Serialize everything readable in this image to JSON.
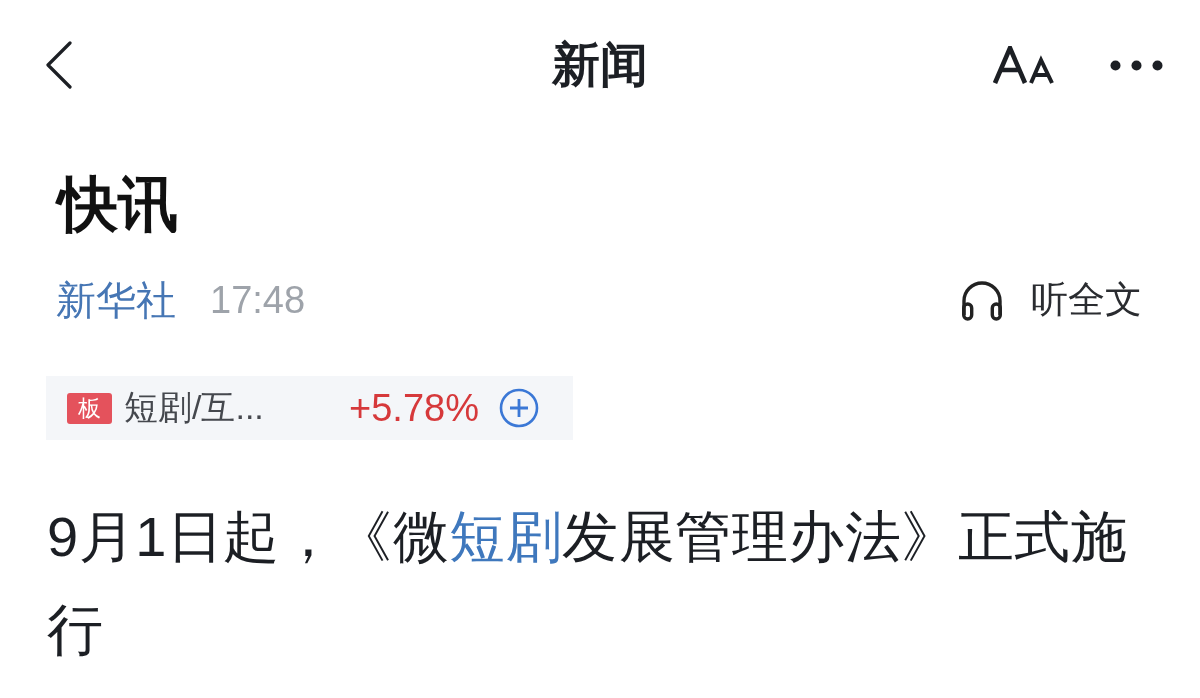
{
  "nav_bar": {
    "title": "新闻"
  },
  "article": {
    "heading": "快讯",
    "source": "新华社",
    "time": "17:48",
    "listen_label": "听全文",
    "stock_tag": {
      "badge": "板",
      "name": "短剧/互...",
      "change": "+5.78%"
    },
    "body": [
      {
        "kind": "text",
        "text": "9月1日起，《微"
      },
      {
        "kind": "link",
        "text": "短剧"
      },
      {
        "kind": "text",
        "text": "发展管理办法》正式施行"
      }
    ]
  }
}
